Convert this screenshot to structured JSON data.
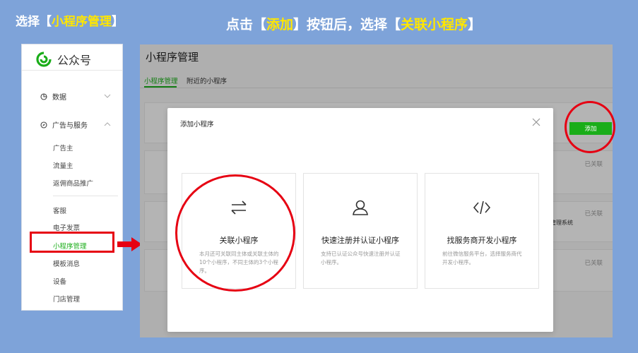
{
  "captions": {
    "left_prefix": "选择【",
    "left_highlight": "小程序管理",
    "left_suffix": "】",
    "top_prefix": "点击【",
    "top_highlight1": "添加",
    "top_middle": "】按钮后，选择【",
    "top_highlight2": "关联小程序",
    "top_suffix": "】"
  },
  "sidebar": {
    "logo_text": "公众号",
    "groups": [
      {
        "label": "数据"
      },
      {
        "label": "广告与服务"
      }
    ],
    "ad_items": [
      "广告主",
      "流量主",
      "返佣商品推广"
    ],
    "items": [
      "客服",
      "电子发票",
      "小程序管理",
      "模板消息",
      "设备",
      "门店管理"
    ],
    "active_item": "小程序管理"
  },
  "panel": {
    "title": "小程序管理",
    "tabs": [
      "小程序管理",
      "附近的小程序"
    ],
    "add_label": "添加",
    "statuses": [
      "已关联",
      "已关联",
      "已关联"
    ],
    "system_text": "管理系统"
  },
  "modal": {
    "title": "添加小程序",
    "options": [
      {
        "title": "关联小程序",
        "desc": "本月还可关联同主体或关联主体的10个小程序，不同主体的3个小程序。",
        "icon": "swap-arrows-icon"
      },
      {
        "title": "快速注册并认证小程序",
        "desc": "支持已认证公众号快速注册并认证小程序。",
        "icon": "user-icon"
      },
      {
        "title": "找服务商开发小程序",
        "desc": "前往微信服务平台，选择服务商代开发小程序。",
        "icon": "code-icon"
      }
    ]
  },
  "colors": {
    "accent": "#1aad19",
    "highlight": "#e60012",
    "caption_highlight": "#ffe600",
    "background": "#7ea3d9"
  }
}
